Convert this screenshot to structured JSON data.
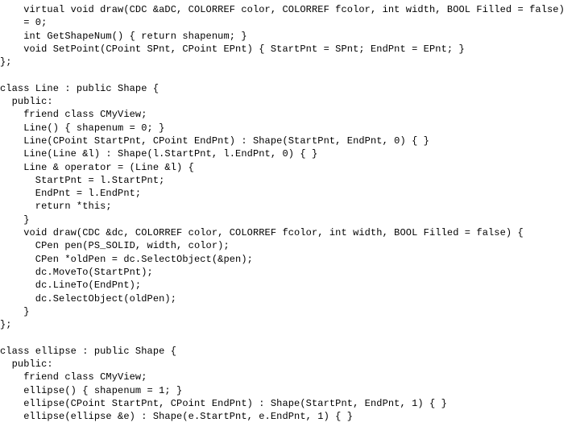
{
  "code": {
    "lines": [
      "    virtual void draw(CDC &aDC, COLORREF color, COLORREF fcolor, int width, BOOL Filled = false)",
      "    = 0;",
      "    int GetShapeNum() { return shapenum; }",
      "    void SetPoint(CPoint SPnt, CPoint EPnt) { StartPnt = SPnt; EndPnt = EPnt; }",
      "};",
      "",
      "class Line : public Shape {",
      "  public:",
      "    friend class CMyView;",
      "    Line() { shapenum = 0; }",
      "    Line(CPoint StartPnt, CPoint EndPnt) : Shape(StartPnt, EndPnt, 0) { }",
      "    Line(Line &l) : Shape(l.StartPnt, l.EndPnt, 0) { }",
      "    Line & operator = (Line &l) {",
      "      StartPnt = l.StartPnt;",
      "      EndPnt = l.EndPnt;",
      "      return *this;",
      "    }",
      "    void draw(CDC &dc, COLORREF color, COLORREF fcolor, int width, BOOL Filled = false) {",
      "      CPen pen(PS_SOLID, width, color);",
      "      CPen *oldPen = dc.SelectObject(&pen);",
      "      dc.MoveTo(StartPnt);",
      "      dc.LineTo(EndPnt);",
      "      dc.SelectObject(oldPen);",
      "    }",
      "};",
      "",
      "class ellipse : public Shape {",
      "  public:",
      "    friend class CMyView;",
      "    ellipse() { shapenum = 1; }",
      "    ellipse(CPoint StartPnt, CPoint EndPnt) : Shape(StartPnt, EndPnt, 1) { }",
      "    ellipse(ellipse &e) : Shape(e.StartPnt, e.EndPnt, 1) { }"
    ]
  }
}
